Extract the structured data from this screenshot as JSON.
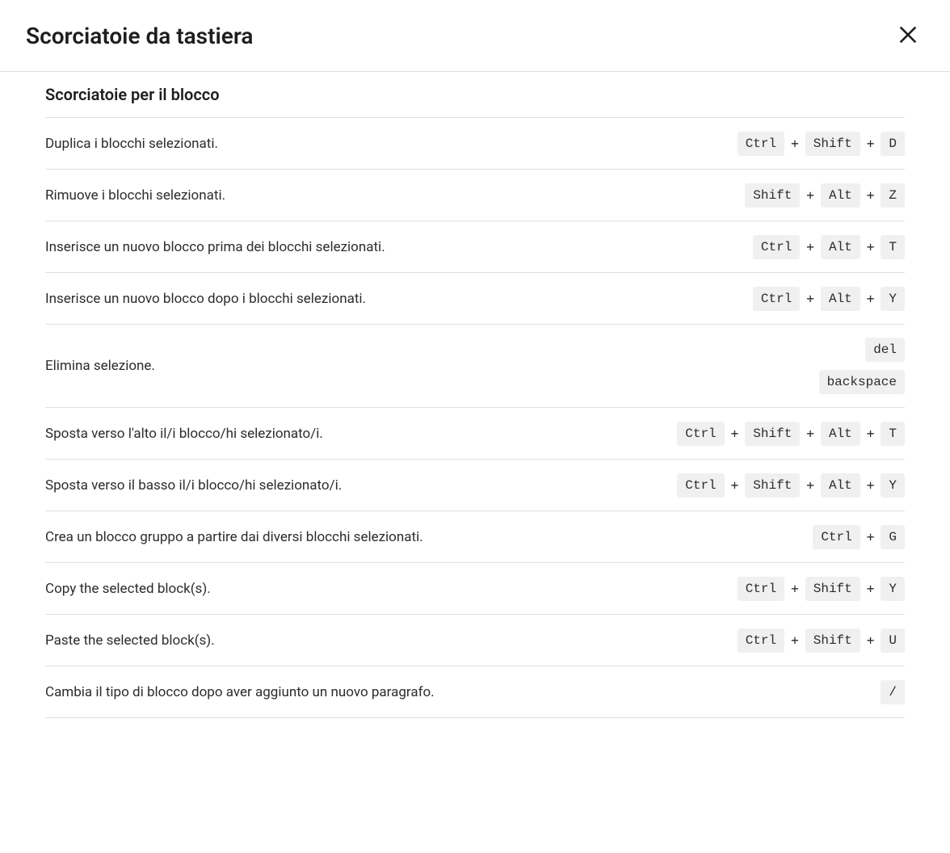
{
  "modal": {
    "title": "Scorciatoie da tastiera",
    "close_label": "Close"
  },
  "section": {
    "title": "Scorciatoie per il blocco",
    "plus": "+",
    "shortcuts": [
      {
        "desc": "Duplica i blocchi selezionati.",
        "combos": [
          [
            "Ctrl",
            "Shift",
            "D"
          ]
        ]
      },
      {
        "desc": "Rimuove i blocchi selezionati.",
        "combos": [
          [
            "Shift",
            "Alt",
            "Z"
          ]
        ]
      },
      {
        "desc": "Inserisce un nuovo blocco prima dei blocchi selezionati.",
        "combos": [
          [
            "Ctrl",
            "Alt",
            "T"
          ]
        ]
      },
      {
        "desc": "Inserisce un nuovo blocco dopo i blocchi selezionati.",
        "combos": [
          [
            "Ctrl",
            "Alt",
            "Y"
          ]
        ]
      },
      {
        "desc": "Elimina selezione.",
        "combos": [
          [
            "del"
          ],
          [
            "backspace"
          ]
        ]
      },
      {
        "desc": "Sposta verso l'alto il/i blocco/hi selezionato/i.",
        "combos": [
          [
            "Ctrl",
            "Shift",
            "Alt",
            "T"
          ]
        ]
      },
      {
        "desc": "Sposta verso il basso il/i blocco/hi selezionato/i.",
        "combos": [
          [
            "Ctrl",
            "Shift",
            "Alt",
            "Y"
          ]
        ]
      },
      {
        "desc": "Crea un blocco gruppo a partire dai diversi blocchi selezionati.",
        "combos": [
          [
            "Ctrl",
            "G"
          ]
        ]
      },
      {
        "desc": "Copy the selected block(s).",
        "combos": [
          [
            "Ctrl",
            "Shift",
            "Y"
          ]
        ]
      },
      {
        "desc": "Paste the selected block(s).",
        "combos": [
          [
            "Ctrl",
            "Shift",
            "U"
          ]
        ]
      },
      {
        "desc": "Cambia il tipo di blocco dopo aver aggiunto un nuovo paragrafo.",
        "combos": [
          [
            "/"
          ]
        ]
      }
    ]
  }
}
